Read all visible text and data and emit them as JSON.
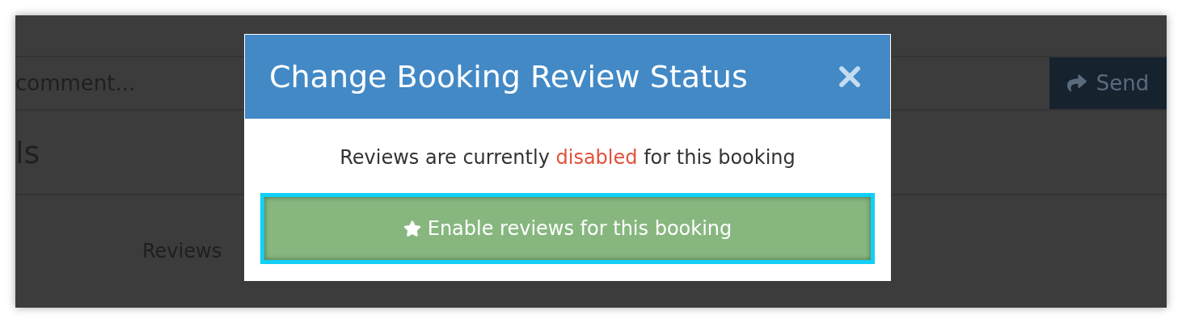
{
  "page": {
    "comment_field": {
      "placeholder": "comment..."
    },
    "send_button": {
      "label": "Send"
    },
    "heading": "ls",
    "reviews_label": "Reviews"
  },
  "modal": {
    "title": "Change Booking Review Status",
    "message": [
      {
        "kind": "plain",
        "text": "Reviews are currently "
      },
      {
        "kind": "status",
        "text": "disabled"
      },
      {
        "kind": "plain",
        "text": " for this booking"
      }
    ],
    "action_button": {
      "label": "Enable reviews for this booking",
      "focused": true
    }
  }
}
